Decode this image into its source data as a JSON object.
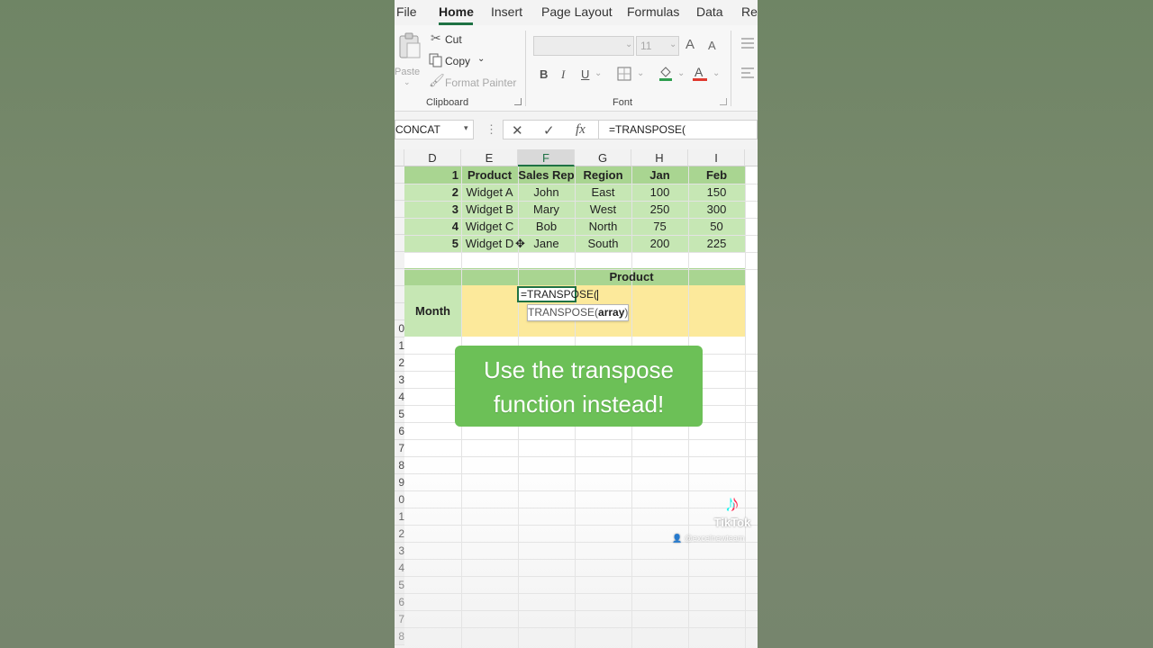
{
  "ribbon_tabs": [
    "File",
    "Home",
    "Insert",
    "Page Layout",
    "Formulas",
    "Data",
    "Rev"
  ],
  "clipboard": {
    "paste": "Paste",
    "cut": "Cut",
    "copy": "Copy",
    "format_painter": "Format Painter",
    "label": "Clipboard"
  },
  "font_group": {
    "size": "11",
    "bold": "B",
    "italic": "I",
    "underline": "U",
    "grow": "A",
    "shrink": "A",
    "font_color": "A",
    "label": "Font"
  },
  "formula_bar": {
    "name_box": "CONCAT",
    "cancel": "✕",
    "enter": "✓",
    "fx": "fx",
    "formula": "=TRANSPOSE("
  },
  "columns": [
    "D",
    "E",
    "F",
    "G",
    "H",
    "I"
  ],
  "row_numbers": [
    "",
    "",
    "",
    "",
    "",
    "",
    "",
    "",
    "",
    "0",
    "1",
    "2",
    "3",
    "4",
    "5",
    "6",
    "7",
    "8",
    "9",
    "0",
    "1",
    "2",
    "3",
    "4",
    "5",
    "6",
    "7",
    "8"
  ],
  "table": {
    "header": [
      "1",
      "Product",
      "Sales Rep",
      "Region",
      "Jan",
      "Feb"
    ],
    "rows": [
      [
        "2",
        "Widget A",
        "John",
        "East",
        "100",
        "150"
      ],
      [
        "3",
        "Widget B",
        "Mary",
        "West",
        "250",
        "300"
      ],
      [
        "4",
        "Widget C",
        "Bob",
        "North",
        "75",
        "50"
      ],
      [
        "5",
        "Widget D",
        "Jane",
        "South",
        "200",
        "225"
      ]
    ]
  },
  "second_table": {
    "product_header": "Product",
    "month_label": "Month"
  },
  "editing": {
    "cell_text": "=TRANSPOSE(",
    "tooltip_fn": "TRANSPOSE(",
    "tooltip_arg": "array",
    "tooltip_close": ")"
  },
  "banner": {
    "line1": "Use the transpose",
    "line2": "function instead!"
  },
  "watermark": {
    "brand": "TikTok",
    "user": "@excelnewteam"
  },
  "colors": {
    "header_green": "#a9d591",
    "data_green": "#c6e7b4",
    "yellow": "#fce99b",
    "banner": "#6cc057",
    "accent": "#1f7244"
  }
}
